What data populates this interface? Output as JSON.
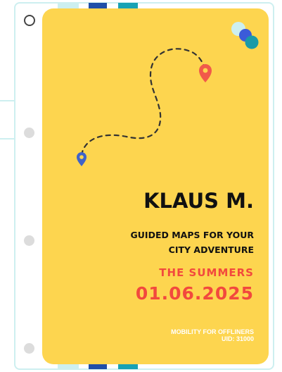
{
  "cover": {
    "name": "KLAUS M.",
    "tagline_line1": "GUIDED MAPS FOR YOUR",
    "tagline_line2": "CITY ADVENTURE",
    "season": "THE SUMMERS",
    "date": "01.06.2025",
    "footer_line1": "MOBILITY FOR OFFLINERS",
    "footer_line2": "UID: 31000"
  },
  "icons": {
    "start_pin": "map-pin-icon",
    "end_pin": "map-pin-icon",
    "logo": "three-dots-logo"
  },
  "colors": {
    "card_background": "#fdd54f",
    "accent_red": "#f2493d",
    "pin_blue": "#3f63c9",
    "pin_red": "#f15a4a",
    "frame_teal": "#cdeff0",
    "dot_light": "#cdeff0",
    "dot_blue": "#3b5bd9",
    "dot_teal": "#1a9aa8",
    "tab_blue": "#1f4fa8",
    "tab_teal": "#18a2b4",
    "tab_light": "#cdeff0"
  }
}
